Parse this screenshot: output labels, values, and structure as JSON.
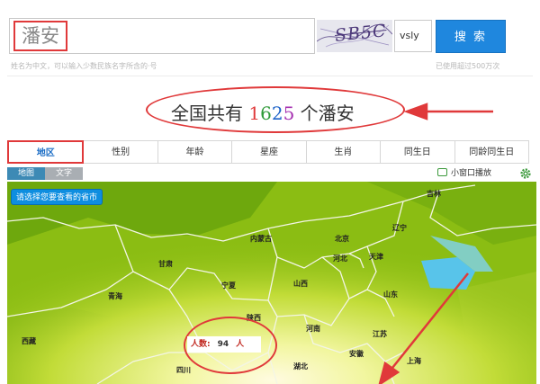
{
  "search": {
    "value": "潘安"
  },
  "captcha": {
    "code": "SB5C",
    "input_value": "vsly"
  },
  "search_button": {
    "label": "搜 索"
  },
  "hints": {
    "left": "姓名为中文，可以输入少数民族名字所含的·号",
    "right": "已使用超过500万次"
  },
  "headline": {
    "prefix": "全国共有 ",
    "digits": [
      "1",
      "6",
      "2",
      "5"
    ],
    "suffix": " 个潘安",
    "digit_colors": [
      "#e0393a",
      "#2f9a39",
      "#1c62c8",
      "#a52fb0"
    ]
  },
  "tabs": [
    "地区",
    "性别",
    "年龄",
    "星座",
    "生肖",
    "同生日",
    "同龄同生日"
  ],
  "active_tab": "地区",
  "map_toolbar": {
    "toggle_on": "地图",
    "toggle_off": "文字",
    "popout_label": "小窗口播放",
    "popout_icon": "tv-icon",
    "settings_icon": "gear-icon"
  },
  "map": {
    "select_prompt": "请选择您要查看的省市",
    "provinces": [
      "吉林",
      "辽宁",
      "内蒙古",
      "北京",
      "河北",
      "天津",
      "甘肃",
      "宁夏",
      "山西",
      "青海",
      "山东",
      "陕西",
      "河南",
      "江苏",
      "西藏",
      "安徽",
      "湖北",
      "上海",
      "四川"
    ],
    "popup": {
      "label": "人数:",
      "count": "94",
      "unit": "人"
    }
  },
  "colors": {
    "accent_red": "#e0393a",
    "button_blue": "#1f87de",
    "map_green": "#8bbd13",
    "active_tab_text": "#1b6dc5"
  }
}
